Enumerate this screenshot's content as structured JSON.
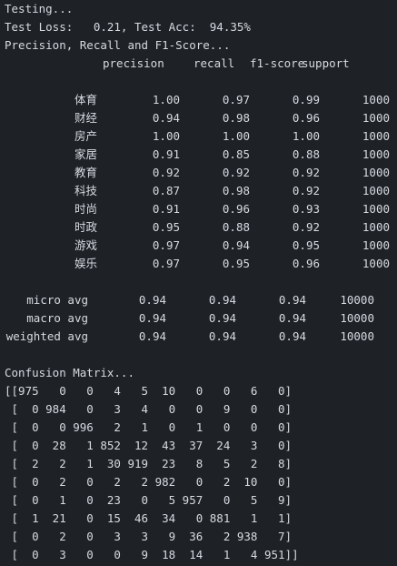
{
  "terminal": {
    "line1": "Testing...",
    "line2": "Test Loss:   0.21, Test Acc:  94.35%",
    "line3": "Precision, Recall and F1-Score...",
    "headers": [
      "precision",
      "recall",
      "f1-score",
      "support"
    ],
    "classes": [
      {
        "label": "体育",
        "precision": "1.00",
        "recall": "0.97",
        "f1": "0.99",
        "support": "1000"
      },
      {
        "label": "财经",
        "precision": "0.94",
        "recall": "0.98",
        "f1": "0.96",
        "support": "1000"
      },
      {
        "label": "房产",
        "precision": "1.00",
        "recall": "1.00",
        "f1": "1.00",
        "support": "1000"
      },
      {
        "label": "家居",
        "precision": "0.91",
        "recall": "0.85",
        "f1": "0.88",
        "support": "1000"
      },
      {
        "label": "教育",
        "precision": "0.92",
        "recall": "0.92",
        "f1": "0.92",
        "support": "1000"
      },
      {
        "label": "科技",
        "precision": "0.87",
        "recall": "0.98",
        "f1": "0.92",
        "support": "1000"
      },
      {
        "label": "时尚",
        "precision": "0.91",
        "recall": "0.96",
        "f1": "0.93",
        "support": "1000"
      },
      {
        "label": "时政",
        "precision": "0.95",
        "recall": "0.88",
        "f1": "0.92",
        "support": "1000"
      },
      {
        "label": "游戏",
        "precision": "0.97",
        "recall": "0.94",
        "f1": "0.95",
        "support": "1000"
      },
      {
        "label": "娱乐",
        "precision": "0.97",
        "recall": "0.95",
        "f1": "0.96",
        "support": "1000"
      }
    ],
    "averages": [
      {
        "label": "micro avg",
        "precision": "0.94",
        "recall": "0.94",
        "f1": "0.94",
        "support": "10000"
      },
      {
        "label": "macro avg",
        "precision": "0.94",
        "recall": "0.94",
        "f1": "0.94",
        "support": "10000"
      },
      {
        "label": "weighted avg",
        "precision": "0.94",
        "recall": "0.94",
        "f1": "0.94",
        "support": "10000"
      }
    ],
    "cm_title": "Confusion Matrix...",
    "cm_lines": [
      "[[975   0   0   4   5  10   0   0   6   0]",
      " [  0 984   0   3   4   0   0   9   0   0]",
      " [  0   0 996   2   1   0   1   0   0   0]",
      " [  0  28   1 852  12  43  37  24   3   0]",
      " [  2   2   1  30 919  23   8   5   2   8]",
      " [  0   2   0   2   2 982   0   2  10   0]",
      " [  0   1   0  23   0   5 957   0   5   9]",
      " [  1  21   0  15  46  34   0 881   1   1]",
      " [  0   2   0   3   3   9  36   2 938   7]",
      " [  0   3   0   0   9  18  14   1   4 951]]"
    ]
  }
}
